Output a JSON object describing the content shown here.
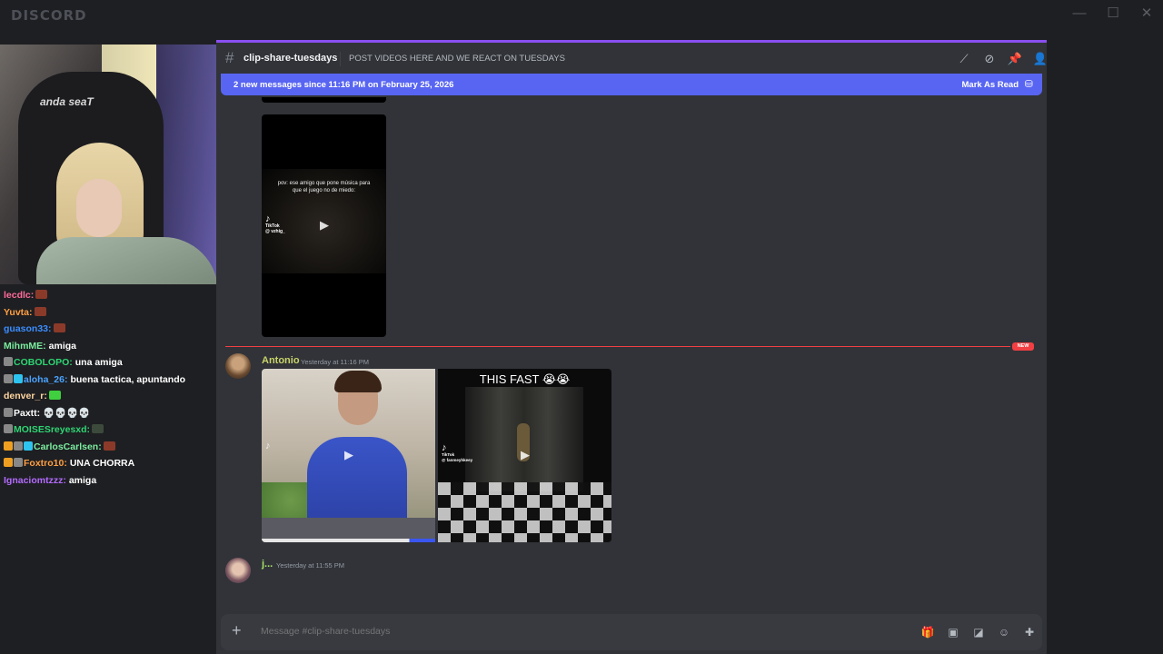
{
  "app": {
    "logo": "DISCORD",
    "minimize": "—",
    "maximize": "☐",
    "close": "✕"
  },
  "stream": {
    "chair_brand": "anda seaT",
    "chat": [
      {
        "user": "lecdlc:",
        "color": "#ff6b9a",
        "msg": "",
        "emote": "#8b3a2a",
        "badges": []
      },
      {
        "user": "Yuvta:",
        "color": "#ff9f43",
        "msg": "",
        "emote": "#8b3a2a",
        "badges": []
      },
      {
        "user": "guason33:",
        "color": "#3a8dff",
        "msg": "",
        "emote": "#8b3a2a",
        "badges": []
      },
      {
        "user": "MihmME:",
        "color": "#7bed9f",
        "msg": "amiga",
        "emote": "",
        "badges": []
      },
      {
        "user": "COBOLOPO:",
        "color": "#2ed573",
        "msg": "una amiga",
        "emote": "",
        "badges": [
          "#888"
        ]
      },
      {
        "user": "aloha_26:",
        "color": "#4aa3ff",
        "msg": "buena tactica, apuntando",
        "emote": "",
        "badges": [
          "#888",
          "#2ec4f0"
        ]
      },
      {
        "user": "denver_r:",
        "color": "#ffd6a0",
        "msg": "",
        "emote": "#3fcf3f",
        "badges": []
      },
      {
        "user": "Paxtt:",
        "color": "#ffffff",
        "msg": "💀💀💀💀",
        "emote": "",
        "badges": [
          "#888"
        ]
      },
      {
        "user": "MOISESreyesxd:",
        "color": "#2ed573",
        "msg": "",
        "emote": "#3c4a3c",
        "badges": [
          "#888"
        ]
      },
      {
        "user": "CarlosCarlsen:",
        "color": "#7bed9f",
        "msg": "",
        "emote": "#8b3a2a",
        "badges": [
          "#f0a020",
          "#888",
          "#2ec4f0"
        ]
      },
      {
        "user": "Foxtro10:",
        "color": "#ff9f43",
        "msg": "UNA CHORRA",
        "emote": "",
        "badges": [
          "#f0a020",
          "#888"
        ]
      },
      {
        "user": "Ignaciomtzzz:",
        "color": "#b36bff",
        "msg": "amiga",
        "emote": "",
        "badges": []
      }
    ]
  },
  "header": {
    "hash": "#",
    "channel": "clip-share-tuesdays",
    "topic": "POST VIDEOS HERE AND WE REACT ON TUESDAYS",
    "icons": [
      "threads-icon",
      "mute-icon",
      "pin-icon",
      "members-icon"
    ]
  },
  "banner": {
    "text": "2 new messages since 11:16 PM on February 25, 2026",
    "action": "Mark As Read",
    "action_icon": "⛁"
  },
  "divider": {
    "label": "NEW"
  },
  "video1": {
    "caption": "pov: ese amigo que pone música para que el juego no de miedo:",
    "tiktok": "TikTok",
    "handle": "@ vzhig_"
  },
  "messages": [
    {
      "author": "Antonio",
      "author_color": "#c9d36a",
      "timestamp": "Yesterday at 11:16 PM"
    },
    {
      "author": "j...",
      "author_color": "#a8e06a",
      "timestamp": "Yesterday at 11:55 PM"
    }
  ],
  "video3": {
    "caption": "THIS FAST 😭😭",
    "tiktok": "TikTok",
    "handle": "@ fanmeyhkeey"
  },
  "video2": {
    "tiktok": "♪"
  },
  "composer": {
    "plus": "+",
    "placeholder": "Message #clip-share-tuesdays"
  },
  "play_glyph": "▶"
}
